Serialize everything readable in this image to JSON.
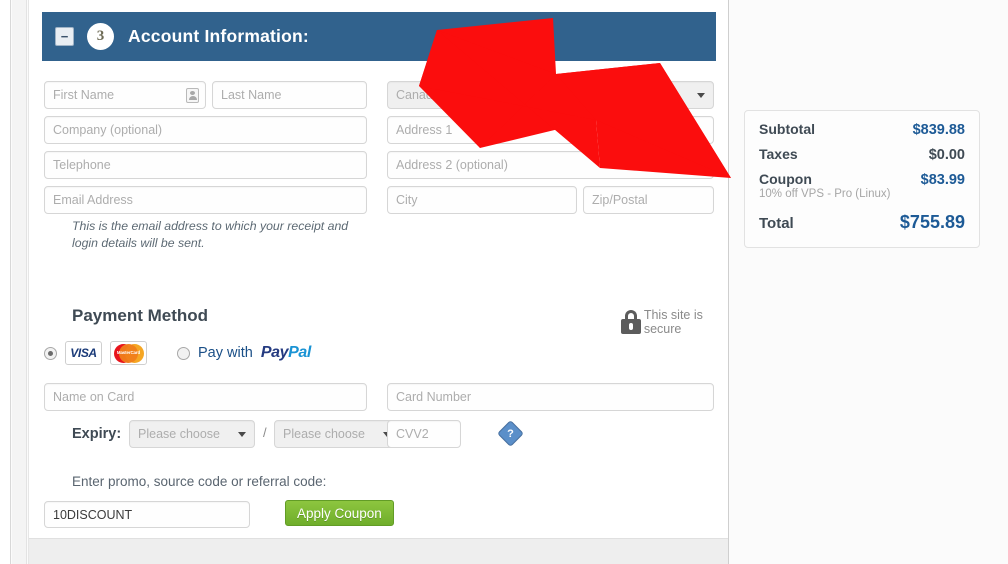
{
  "section": {
    "step_number": "3",
    "title": "Account Information:",
    "collapse_icon": "minus-icon",
    "header_color": "#31628d"
  },
  "form": {
    "first_name": {
      "placeholder": "First Name",
      "value": ""
    },
    "last_name": {
      "placeholder": "Last Name",
      "value": ""
    },
    "company": {
      "placeholder": "Company (optional)",
      "value": ""
    },
    "telephone": {
      "placeholder": "Telephone",
      "value": ""
    },
    "email": {
      "placeholder": "Email Address",
      "value": ""
    },
    "country": {
      "selected": "Canada"
    },
    "address1": {
      "placeholder": "Address 1",
      "value": ""
    },
    "address2": {
      "placeholder": "Address 2 (optional)",
      "value": ""
    },
    "city": {
      "placeholder": "City",
      "value": ""
    },
    "zip": {
      "placeholder": "Zip/Postal",
      "value": ""
    },
    "email_helper": "This is the email address to which your receipt and login details will be sent."
  },
  "payment": {
    "title": "Payment Method",
    "secure_text": "This site is secure",
    "secure_icon": "lock-icon",
    "card_option_selected": true,
    "visa_label": "VISA",
    "mastercard_label": "MasterCard",
    "paypal_prefix": "Pay with",
    "paypal_pay": "Pay",
    "paypal_pal": "Pal",
    "name_on_card": {
      "placeholder": "Name on Card",
      "value": ""
    },
    "card_number": {
      "placeholder": "Card Number",
      "value": ""
    },
    "expiry_label": "Expiry:",
    "expiry_month": "Please choose",
    "expiry_year": "Please choose",
    "expiry_separator": "/",
    "cvv": {
      "placeholder": "CVV2",
      "value": ""
    },
    "cvv_help_icon": "question-mark-icon",
    "cvv_help_glyph": "?"
  },
  "promo": {
    "label": "Enter promo, source code or referral code:",
    "input_value": "10DISCOUNT",
    "apply_button": "Apply Coupon",
    "button_color": "#7cb82f"
  },
  "summary": {
    "rows": [
      {
        "label": "Subtotal",
        "amount": "$839.88",
        "highlight": true
      },
      {
        "label": "Taxes",
        "amount": "$0.00",
        "highlight": false
      },
      {
        "label": "Coupon",
        "amount": "$83.99",
        "highlight": true
      }
    ],
    "coupon_description": "10% off VPS - Pro (Linux)",
    "total_label": "Total",
    "total_amount": "$755.89",
    "accent_color": "#1d5a96"
  },
  "annotation": {
    "arrow_color": "#fb0d0d",
    "arrow_name": "red-pointer-arrow"
  }
}
